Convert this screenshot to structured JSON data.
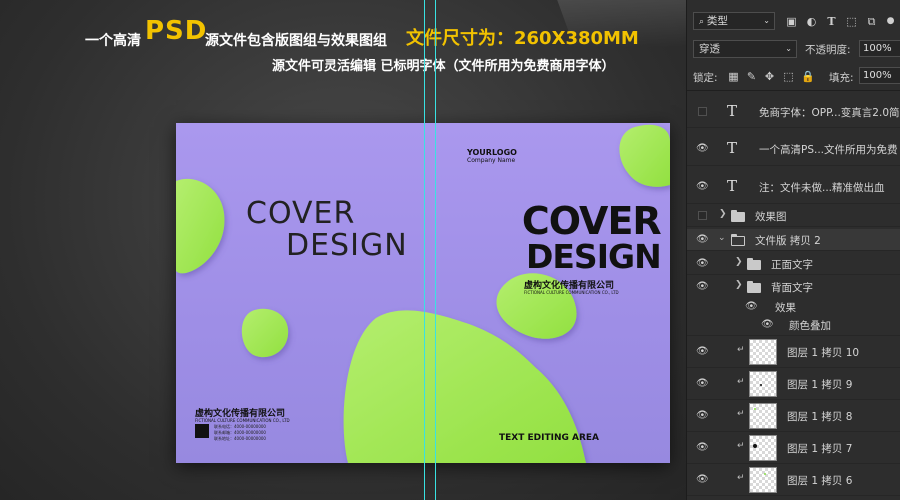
{
  "headline": {
    "line1_prefix": "一个高清",
    "psd": "PSD",
    "line1_suffix": "源文件包含版图组与效果图组",
    "size": "文件尺寸为：260X380MM",
    "line2": "源文件可灵活编辑 已标明字体（文件所用为免费商用字体）"
  },
  "cover": {
    "left_title_line1": "COVER",
    "left_title_line2": "DESIGN",
    "logo_main": "YOURLOGO",
    "logo_sub": "Company Name",
    "right_title_line1": "COVER",
    "right_title_line2": "DESIGN",
    "right_company": "虚构文化传播有限公司",
    "right_company_en": "FICTIONAL CULTURE COMMUNICATION CO., LTD",
    "left_company": "虚构文化传播有限公司",
    "left_company_en": "FICTIONAL CULTURE COMMUNICATION CO., LTD",
    "contact_lines": [
      "联系电话：4000-00000000",
      "联系邮箱：4000-00000000",
      "联系地址：4000-00000000"
    ],
    "text_editing": "TEXT EDITING AREA",
    "colors": {
      "background": "#a596ec",
      "blob": "#9ee44f"
    }
  },
  "panel": {
    "filter_kind": "类型",
    "blend_mode": "穿透",
    "opacity_label": "不透明度:",
    "opacity_value": "100%",
    "lock_label": "锁定:",
    "fill_label": "填充:",
    "fill_value": "100%",
    "layers": [
      {
        "name": "免商字体：OPP...变真言2.0简",
        "type": "text",
        "visible": false
      },
      {
        "name": "一个高清PS...文件所用为免费",
        "type": "text",
        "visible": true
      },
      {
        "name": "注：文件未做...精准做出血",
        "type": "text",
        "visible": true
      },
      {
        "name": "效果图",
        "type": "folder",
        "visible": false
      },
      {
        "name": "文件版 拷贝 2",
        "type": "folder-open",
        "visible": true
      },
      {
        "name": "正面文字",
        "type": "folder",
        "visible": true
      },
      {
        "name": "背面文字",
        "type": "folder",
        "visible": true
      },
      {
        "name": "效果",
        "type": "effects",
        "visible": true
      },
      {
        "name": "颜色叠加",
        "type": "effect",
        "visible": true
      },
      {
        "name": "图层 1 拷贝 10",
        "type": "pixel",
        "visible": true
      },
      {
        "name": "图层 1 拷贝 9",
        "type": "pixel",
        "visible": true
      },
      {
        "name": "图层 1 拷贝 8",
        "type": "pixel",
        "visible": true
      },
      {
        "name": "图层 1 拷贝 7",
        "type": "pixel",
        "visible": true
      },
      {
        "name": "图层 1 拷贝 6",
        "type": "pixel",
        "visible": true
      }
    ]
  }
}
